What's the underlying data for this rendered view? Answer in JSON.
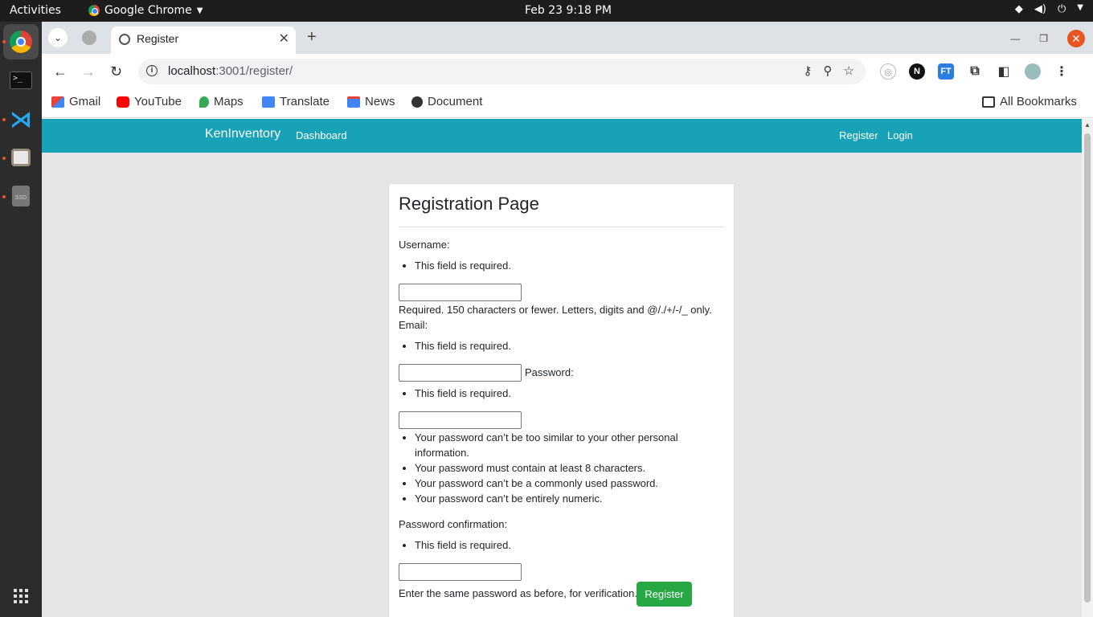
{
  "system": {
    "activities": "Activities",
    "app_name": "Google Chrome",
    "clock": "Feb 23  9:18 PM"
  },
  "browser": {
    "tab_title": "Register",
    "url_host": "localhost",
    "url_path": ":3001/register/",
    "bookmarks": [
      "Gmail",
      "YouTube",
      "Maps",
      "Translate",
      "News",
      "Document"
    ],
    "all_bookmarks": "All Bookmarks"
  },
  "navbar": {
    "brand": "KenInventory",
    "dashboard": "Dashboard",
    "register": "Register",
    "login": "Login"
  },
  "form": {
    "title": "Registration Page",
    "username_label": "Username:",
    "username_error": "This field is required.",
    "username_help": "Required. 150 characters or fewer. Letters, digits and @/./+/-/_ only.",
    "email_label": "Email:",
    "email_error": "This field is required.",
    "password_label": "Password:",
    "password_error": "This field is required.",
    "password_rules": [
      "Your password can’t be too similar to your other personal information.",
      "Your password must contain at least 8 characters.",
      "Your password can’t be a commonly used password.",
      "Your password can’t be entirely numeric."
    ],
    "confirm_label": "Password confirmation:",
    "confirm_error": "This field is required.",
    "confirm_help": "Enter the same password as before, for verification.",
    "submit_label": "Register"
  }
}
